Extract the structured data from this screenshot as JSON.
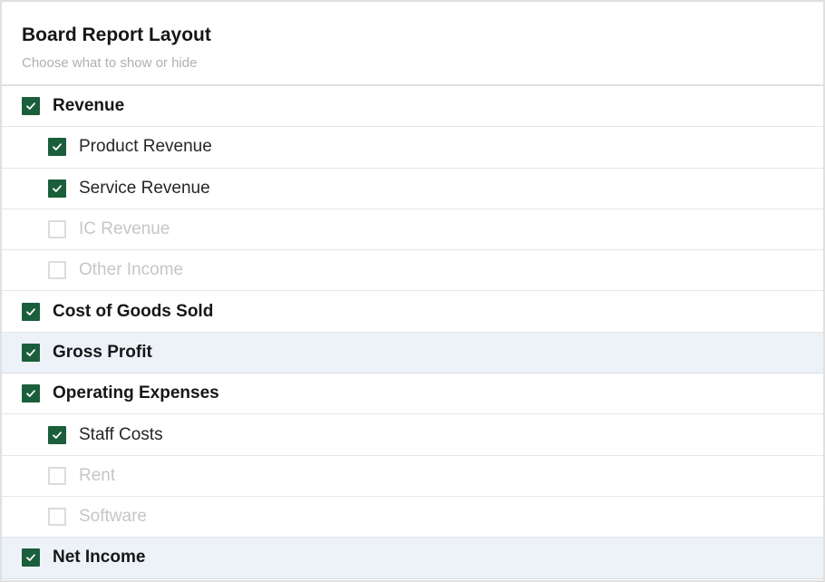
{
  "header": {
    "title": "Board Report Layout",
    "subtitle": "Choose what to show or hide"
  },
  "colors": {
    "checked": "#1b5e3b",
    "highlight_row": "#edf2f9",
    "disabled_text": "#c6c6c6"
  },
  "icons": {
    "checked": "check-icon"
  },
  "rows": [
    {
      "label": "Revenue",
      "checked": true,
      "level": 0,
      "highlight": false
    },
    {
      "label": "Product Revenue",
      "checked": true,
      "level": 1,
      "highlight": false
    },
    {
      "label": "Service Revenue",
      "checked": true,
      "level": 1,
      "highlight": false
    },
    {
      "label": "IC Revenue",
      "checked": false,
      "level": 1,
      "highlight": false
    },
    {
      "label": "Other Income",
      "checked": false,
      "level": 1,
      "highlight": false
    },
    {
      "label": "Cost of Goods Sold",
      "checked": true,
      "level": 0,
      "highlight": false
    },
    {
      "label": "Gross Profit",
      "checked": true,
      "level": 0,
      "highlight": true
    },
    {
      "label": "Operating Expenses",
      "checked": true,
      "level": 0,
      "highlight": false
    },
    {
      "label": "Staff Costs",
      "checked": true,
      "level": 1,
      "highlight": false
    },
    {
      "label": "Rent",
      "checked": false,
      "level": 1,
      "highlight": false
    },
    {
      "label": "Software",
      "checked": false,
      "level": 1,
      "highlight": false
    },
    {
      "label": "Net Income",
      "checked": true,
      "level": 0,
      "highlight": true
    }
  ]
}
